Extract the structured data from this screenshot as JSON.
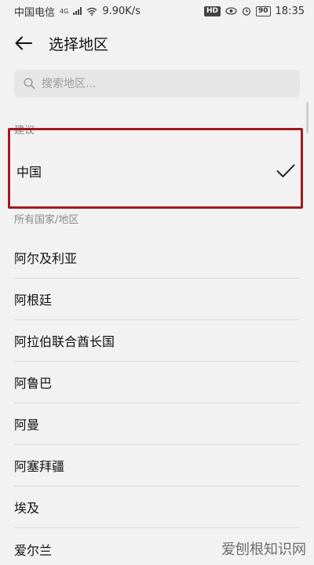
{
  "status_bar": {
    "carrier": "中国电信",
    "network": "4G",
    "speed": "9.90K/s",
    "hd_badge": "HD",
    "battery": "90",
    "time": "18:35"
  },
  "header": {
    "back_icon": "arrow-left-icon",
    "title": "选择地区"
  },
  "search": {
    "placeholder": "搜索地区...",
    "value": ""
  },
  "suggested": {
    "label": "建议",
    "items": [
      {
        "name": "中国",
        "selected": true
      }
    ]
  },
  "all_regions": {
    "label": "所有国家/地区",
    "items": [
      "阿尔及利亚",
      "阿根廷",
      "阿拉伯联合酋长国",
      "阿鲁巴",
      "阿曼",
      "阿塞拜疆",
      "埃及",
      "爱尔兰"
    ]
  },
  "watermark": "爱刨根知识网",
  "colors": {
    "highlight_border": "#a3191d",
    "background": "#f2f2f2"
  }
}
